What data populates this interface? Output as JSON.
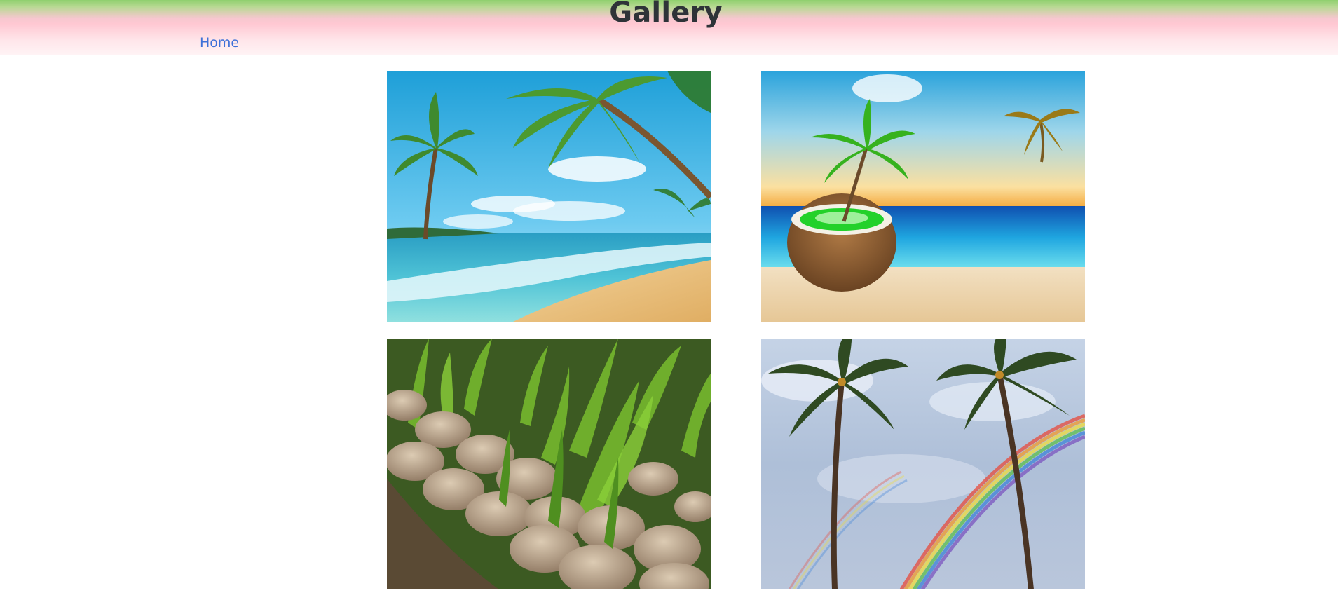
{
  "header": {
    "title": "Gallery",
    "nav": {
      "home_label": "Home"
    }
  },
  "gallery": {
    "images": [
      {
        "subject": "tropical-beach-with-palm-trees",
        "icon": "beach-image"
      },
      {
        "subject": "coconut-with-palm-tree-on-beach",
        "icon": "coconut-palm-image"
      },
      {
        "subject": "sprouting-coconut-seedlings",
        "icon": "coconut-seedlings-image"
      },
      {
        "subject": "palm-trees-with-rainbow",
        "icon": "palm-rainbow-image"
      }
    ]
  },
  "colors": {
    "header_top": "#8fcf6e",
    "header_pink": "#ffc8d2",
    "link": "#3f71d8",
    "title": "#2e3338"
  }
}
